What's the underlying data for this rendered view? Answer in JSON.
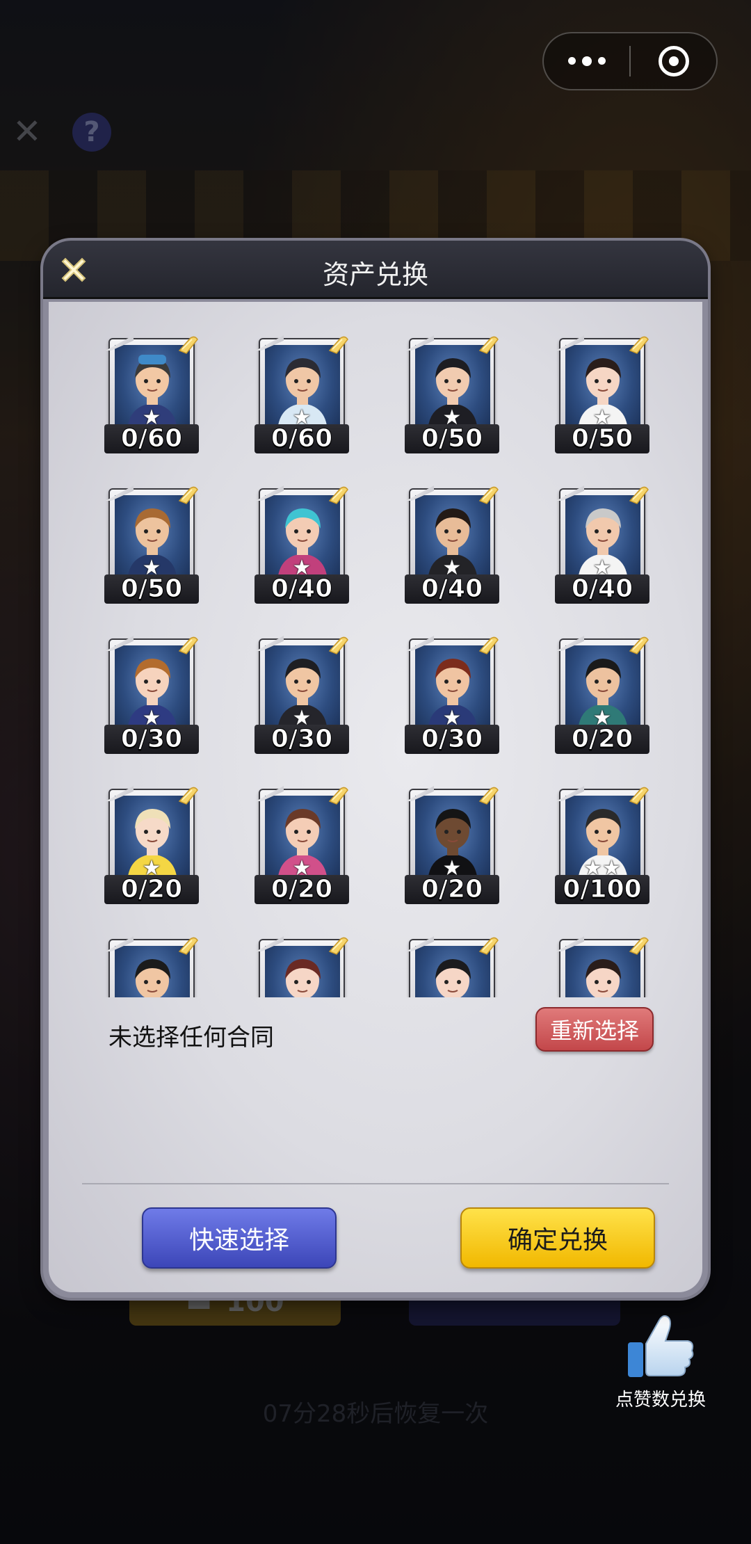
{
  "colors": {
    "accent_blue": "#4a55c8",
    "accent_yellow": "#f8cc16",
    "danger_red": "#cf5a5c",
    "header_dark": "#2b2c35"
  },
  "capsule": {
    "more_icon": "more-dots-icon",
    "close_icon": "target-close-icon"
  },
  "background": {
    "timer_text": "07分28秒后恢复一次",
    "reward_amount": "100",
    "thumb_label": "点赞数兑换"
  },
  "modal": {
    "title": "资产兑换",
    "no_selection_text": "未选择任何合同",
    "reselect_label": "重新选择",
    "quick_select_label": "快速选择",
    "confirm_label": "确定兑换",
    "cards": [
      {
        "count": "0/60",
        "stars": 1,
        "skin": "#f2c8a4",
        "hair": "#3a3a3a",
        "outfit": "#2f3d7a",
        "hat": "#3f8ac8"
      },
      {
        "count": "0/60",
        "stars": 1,
        "skin": "#f0c7a6",
        "hair": "#2b2b33",
        "outfit": "#d8e8f4"
      },
      {
        "count": "0/50",
        "stars": 1,
        "skin": "#f1cbb0",
        "hair": "#1d1d22",
        "outfit": "#1e1e24"
      },
      {
        "count": "0/50",
        "stars": 1,
        "skin": "#f6d6c4",
        "hair": "#2a1d1a",
        "outfit": "#f4f4f4"
      },
      {
        "count": "0/50",
        "stars": 1,
        "skin": "#edc39e",
        "hair": "#a86a33",
        "outfit": "#253868"
      },
      {
        "count": "0/40",
        "stars": 1,
        "skin": "#f3ccb4",
        "hair": "#3fc4d2",
        "outfit": "#c1407c"
      },
      {
        "count": "0/40",
        "stars": 1,
        "skin": "#e8bc98",
        "hair": "#231a16",
        "outfit": "#232327"
      },
      {
        "count": "0/40",
        "stars": 1,
        "skin": "#f1c9ad",
        "hair": "#c9c9c9",
        "outfit": "#f4f4f4"
      },
      {
        "count": "0/30",
        "stars": 1,
        "skin": "#f6d3bd",
        "hair": "#b36c2e",
        "outfit": "#2e3b82"
      },
      {
        "count": "0/30",
        "stars": 1,
        "skin": "#f0c6a3",
        "hair": "#1e1e22",
        "outfit": "#25252b"
      },
      {
        "count": "0/30",
        "stars": 1,
        "skin": "#f0c4a2",
        "hair": "#7c2c1c",
        "outfit": "#2a3a78"
      },
      {
        "count": "0/20",
        "stars": 1,
        "skin": "#edc29f",
        "hair": "#1a1a1a",
        "outfit": "#2f7a77"
      },
      {
        "count": "0/20",
        "stars": 1,
        "skin": "#f6dac8",
        "hair": "#efe0b8",
        "outfit": "#f4d644"
      },
      {
        "count": "0/20",
        "stars": 1,
        "skin": "#f4cdb6",
        "hair": "#6a3a28",
        "outfit": "#d1508a"
      },
      {
        "count": "0/20",
        "stars": 1,
        "skin": "#6e4a32",
        "hair": "#151515",
        "outfit": "#111114"
      },
      {
        "count": "0/100",
        "stars": 2,
        "skin": "#f0c6a3",
        "hair": "#2a2a2a",
        "outfit": "#f4f4f4"
      },
      {
        "count": "",
        "stars": 0,
        "skin": "#f0c6a3",
        "hair": "#1b1b1b",
        "outfit": "#2b2b2f"
      },
      {
        "count": "",
        "stars": 0,
        "skin": "#f6d6c6",
        "hair": "#6a2a24",
        "outfit": "#3f6db8"
      },
      {
        "count": "",
        "stars": 0,
        "skin": "#f6d6c6",
        "hair": "#1b1b1e",
        "outfit": "#f4f4f4"
      },
      {
        "count": "",
        "stars": 0,
        "skin": "#f6d6c6",
        "hair": "#2a1d1a",
        "outfit": "#dff0f4"
      }
    ]
  }
}
